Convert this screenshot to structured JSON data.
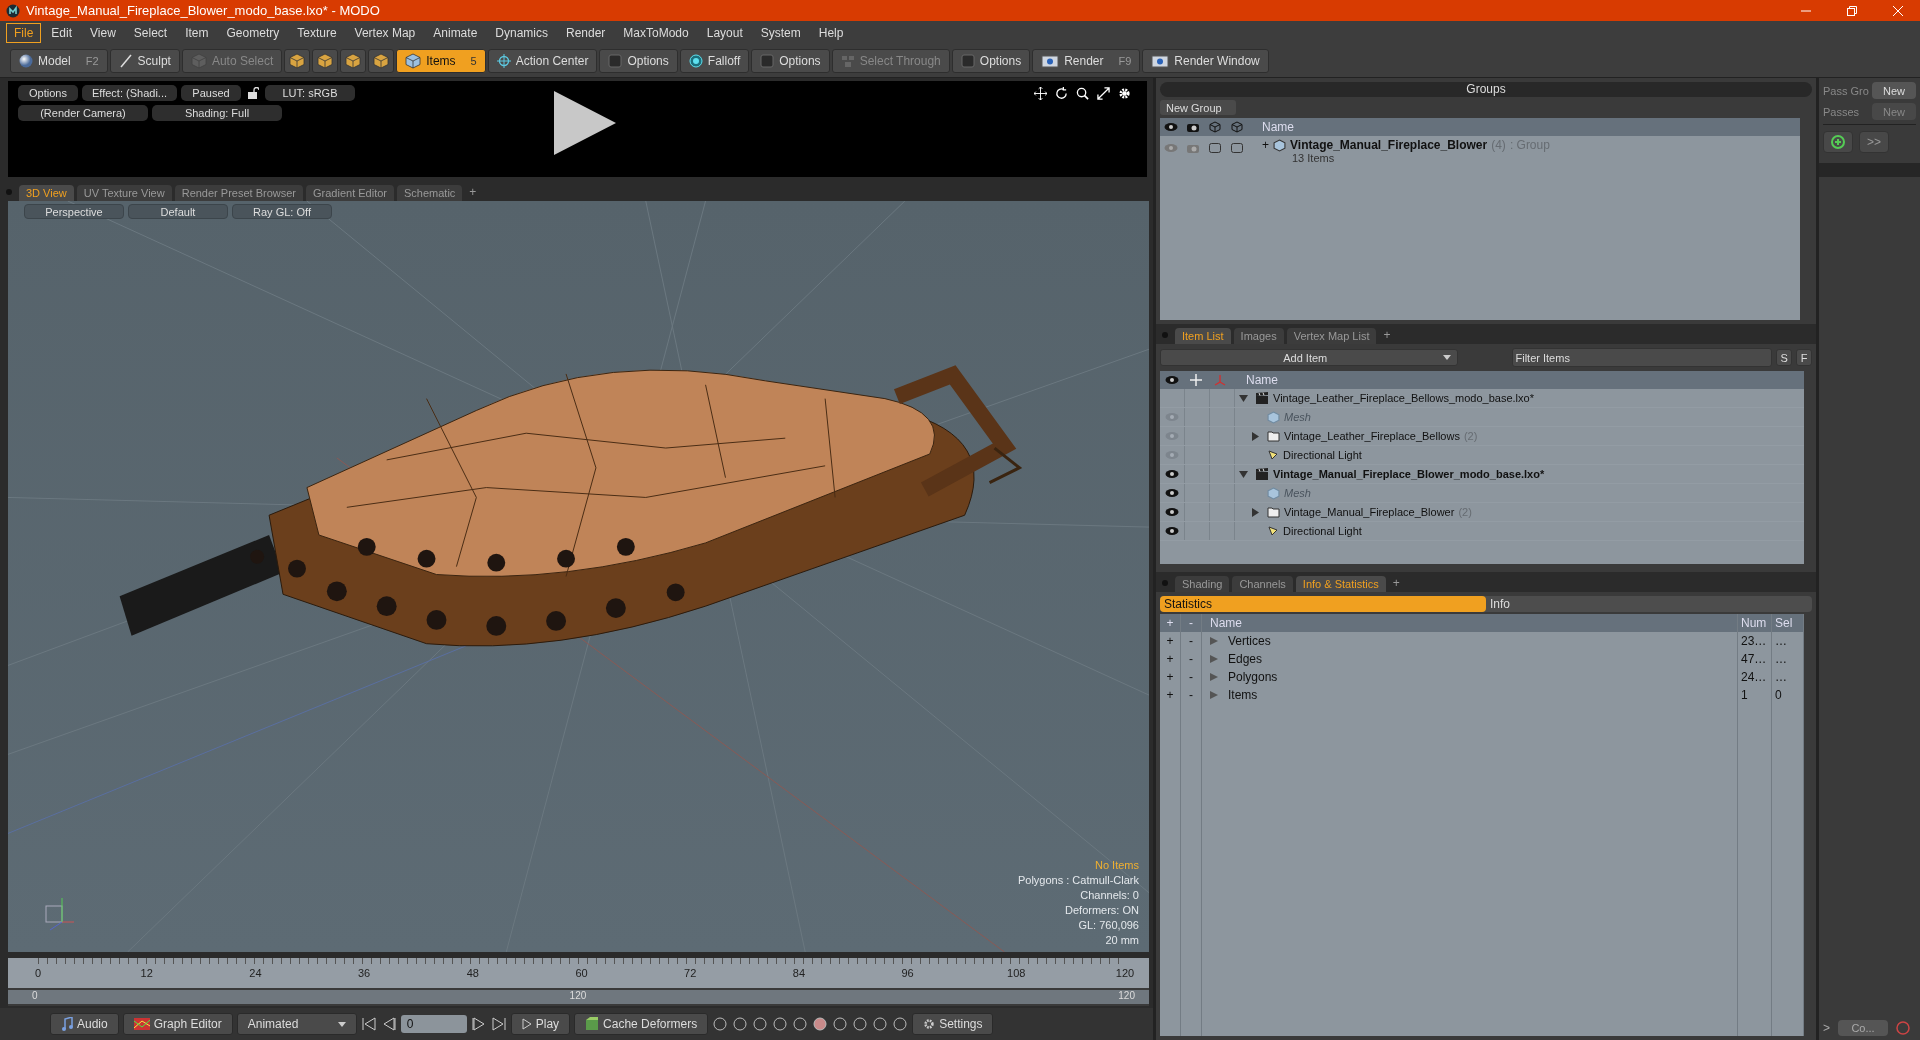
{
  "window": {
    "title": "Vintage_Manual_Fireplace_Blower_modo_base.lxo* - MODO"
  },
  "menu": [
    {
      "label": "File",
      "selected": true
    },
    {
      "label": "Edit",
      "selected": false
    },
    {
      "label": "View",
      "selected": false
    },
    {
      "label": "Select",
      "selected": false
    },
    {
      "label": "Item",
      "selected": false
    },
    {
      "label": "Geometry",
      "selected": false
    },
    {
      "label": "Texture",
      "selected": false
    },
    {
      "label": "Vertex Map",
      "selected": false
    },
    {
      "label": "Animate",
      "selected": false
    },
    {
      "label": "Dynamics",
      "selected": false
    },
    {
      "label": "Render",
      "selected": false
    },
    {
      "label": "MaxToModo",
      "selected": false
    },
    {
      "label": "Layout",
      "selected": false
    },
    {
      "label": "System",
      "selected": false
    },
    {
      "label": "Help",
      "selected": false
    }
  ],
  "toolbar": [
    {
      "kind": "sphere",
      "label": "Model",
      "shortcut": "F2",
      "selected": false,
      "disabled": false
    },
    {
      "kind": "brush",
      "label": "Sculpt",
      "selected": false,
      "disabled": false
    },
    {
      "kind": "cube",
      "label": "Auto Select",
      "selected": false,
      "disabled": true
    },
    {
      "kind": "mode",
      "selected": false,
      "disabled": false
    },
    {
      "kind": "mode",
      "selected": false,
      "disabled": false
    },
    {
      "kind": "mode",
      "selected": false,
      "disabled": false
    },
    {
      "kind": "mode",
      "selected": false,
      "disabled": false
    },
    {
      "kind": "items",
      "label": "Items",
      "shortcut": "5",
      "selected": true,
      "disabled": false
    },
    {
      "kind": "crosshair",
      "label": "Action Center",
      "selected": false,
      "disabled": false
    },
    {
      "kind": "box",
      "label": "Options",
      "selected": false,
      "disabled": false
    },
    {
      "kind": "falloff",
      "label": "Falloff",
      "selected": false,
      "disabled": false
    },
    {
      "kind": "box",
      "label": "Options",
      "selected": false,
      "disabled": false
    },
    {
      "kind": "through",
      "label": "Select Through",
      "selected": false,
      "disabled": true
    },
    {
      "kind": "box",
      "label": "Options",
      "selected": false,
      "disabled": false
    },
    {
      "kind": "render",
      "label": "Render",
      "shortcut": "F9",
      "selected": false,
      "disabled": false
    },
    {
      "kind": "window",
      "label": "Render Window",
      "selected": false,
      "disabled": false
    }
  ],
  "render_preview": {
    "top_buttons": [
      "Options",
      "Effect: (Shadi...",
      "Paused"
    ],
    "lut": "LUT: sRGB",
    "bottom_buttons": [
      "(Render Camera)",
      "Shading: Full"
    ]
  },
  "viewport": {
    "tabs": [
      {
        "label": "3D View",
        "selected": true
      },
      {
        "label": "UV Texture View",
        "selected": false
      },
      {
        "label": "Render Preset Browser",
        "selected": false
      },
      {
        "label": "Gradient Editor",
        "selected": false
      },
      {
        "label": "Schematic",
        "selected": false
      }
    ],
    "add_tab": "+",
    "buttons": [
      "Perspective",
      "Default",
      "Ray GL: Off"
    ],
    "overlay": {
      "status": "No Items",
      "lines": [
        "Polygons : Catmull-Clark",
        "Channels: 0",
        "Deformers: ON",
        "GL: 760,096",
        "20 mm"
      ]
    }
  },
  "timeline": {
    "ticks": [
      "0",
      "12",
      "24",
      "36",
      "48",
      "60",
      "72",
      "84",
      "96",
      "108",
      "120"
    ],
    "start": "0",
    "middle": "120",
    "end": "120"
  },
  "transport": {
    "audio": "Audio",
    "graph_editor": "Graph Editor",
    "mode": "Animated",
    "frame": "0",
    "play": "Play",
    "cache": "Cache Deformers",
    "settings": "Settings"
  },
  "groups": {
    "title": "Groups",
    "new_button": "New Group",
    "column": "Name",
    "rows": [
      {
        "name": "Vintage_Manual_Fireplace_Blower",
        "count": "(4)",
        "type": ": Group",
        "detail": "13 Items",
        "expand": "+"
      }
    ]
  },
  "passes": {
    "group_label": "Pass Gro",
    "group_button": "New",
    "passes_label": "Passes",
    "passes_button": "New",
    "passes_disabled": true,
    "more": ">>"
  },
  "item_list": {
    "tabs": [
      {
        "label": "Item List",
        "selected": true
      },
      {
        "label": "Images",
        "selected": false
      },
      {
        "label": "Vertex Map List",
        "selected": false
      }
    ],
    "add_tab": "+",
    "add_item": "Add Item",
    "filter_placeholder": "Filter Items",
    "buttons": [
      "S",
      "F"
    ],
    "column": "Name",
    "items": [
      {
        "kind": "scene",
        "name": "Vintage_Leather_Fireplace_Bellows_modo_base.lxo*",
        "current": false,
        "expanded": true,
        "children": [
          {
            "kind": "mesh",
            "name": "Mesh",
            "visible": false,
            "disabled": true
          },
          {
            "kind": "group",
            "name": "Vintage_Leather_Fireplace_Bellows",
            "count": "(2)",
            "visible": false,
            "disabled": false,
            "expanded": false
          },
          {
            "kind": "light",
            "name": "Directional Light",
            "visible": false,
            "disabled": false
          }
        ]
      },
      {
        "kind": "scene",
        "name": "Vintage_Manual_Fireplace_Blower_modo_base.lxo*",
        "current": true,
        "visible": true,
        "expanded": true,
        "children": [
          {
            "kind": "mesh",
            "name": "Mesh",
            "visible": true,
            "disabled": true
          },
          {
            "kind": "group",
            "name": "Vintage_Manual_Fireplace_Blower",
            "count": "(2)",
            "visible": true,
            "disabled": false,
            "expanded": false
          },
          {
            "kind": "light",
            "name": "Directional Light",
            "visible": true,
            "disabled": false
          }
        ]
      }
    ]
  },
  "info": {
    "tabs": [
      {
        "label": "Shading",
        "selected": false
      },
      {
        "label": "Channels",
        "selected": false
      },
      {
        "label": "Info & Statistics",
        "selected": true
      }
    ],
    "add_tab": "+",
    "subtabs": [
      {
        "label": "Statistics",
        "selected": true
      },
      {
        "label": "Info",
        "selected": false
      }
    ],
    "columns": [
      "+",
      "-",
      "Name",
      "Num",
      "Sel"
    ],
    "rows": [
      {
        "plus": "+",
        "minus": "-",
        "name": "Vertices",
        "num": "23…",
        "sel": "…"
      },
      {
        "plus": "+",
        "minus": "-",
        "name": "Edges",
        "num": "47…",
        "sel": "…"
      },
      {
        "plus": "+",
        "minus": "-",
        "name": "Polygons",
        "num": "24…",
        "sel": "…"
      },
      {
        "plus": "+",
        "minus": "-",
        "name": "Items",
        "num": "1",
        "sel": "0"
      }
    ]
  },
  "footer": {
    "collapse": ">",
    "button": "Co..."
  }
}
